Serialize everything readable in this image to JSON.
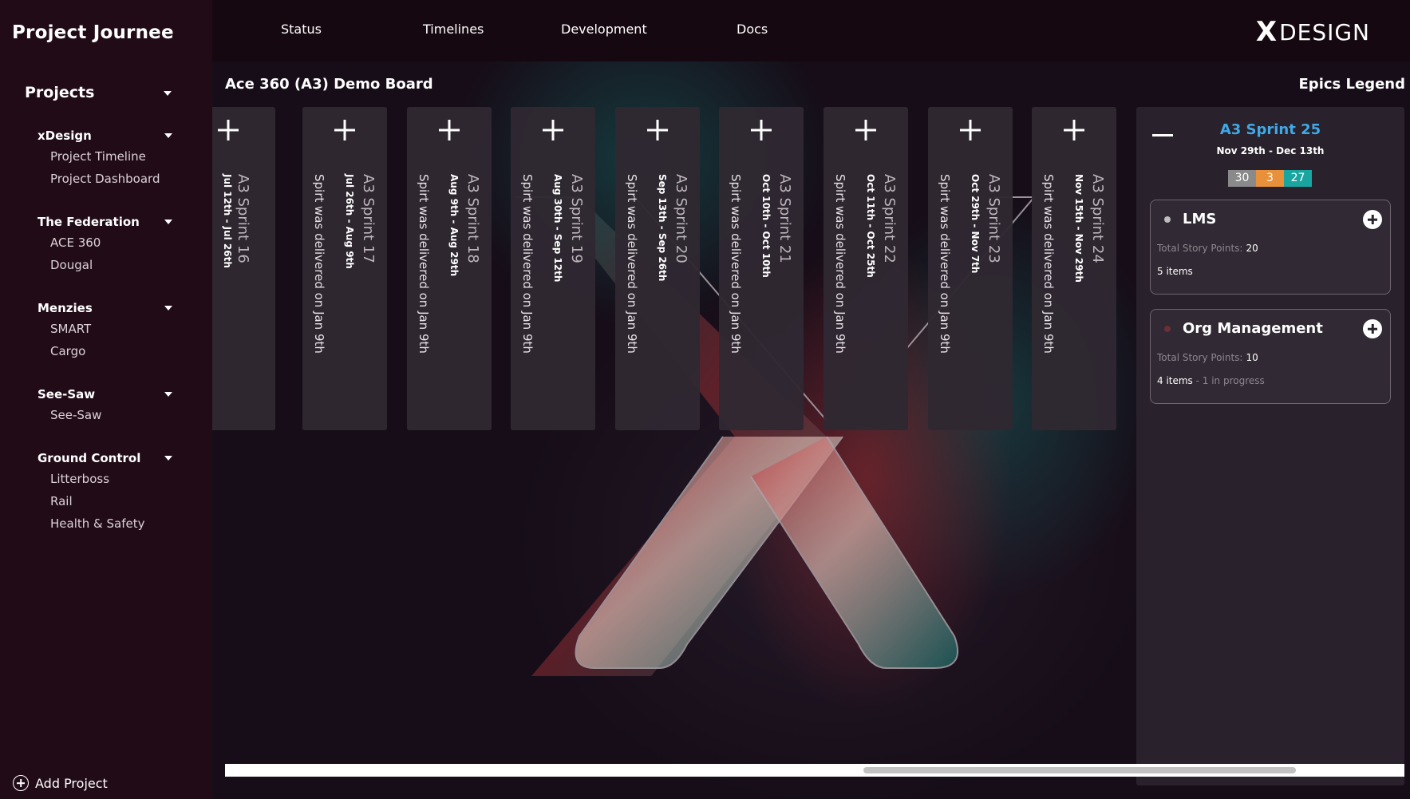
{
  "sidebar": {
    "app_title": "Project Journee",
    "projects_label": "Projects",
    "groups": [
      {
        "title": "xDesign",
        "items": [
          "Project Timeline",
          "Project Dashboard"
        ]
      },
      {
        "title": "The Federation",
        "items": [
          "ACE 360",
          "Dougal"
        ]
      },
      {
        "title": "Menzies",
        "items": [
          "SMART",
          "Cargo"
        ]
      },
      {
        "title": "See-Saw",
        "items": [
          "See-Saw"
        ]
      },
      {
        "title": "Ground Control",
        "items": [
          "Litterboss",
          "Rail",
          "Health & Safety"
        ]
      }
    ],
    "add_project_label": "Add Project"
  },
  "topbar": {
    "nav": [
      "Status",
      "Timelines",
      "Development",
      "Docs"
    ],
    "brand_x": "X",
    "brand_text": "DESIGN"
  },
  "board": {
    "title": "Ace 360 (A3) Demo Board",
    "legend_title": "Epics Legend",
    "sprints": [
      {
        "name": "A3 Sprint 16",
        "dates": "Jul 12th - Jul 26th",
        "note": ""
      },
      {
        "name": "A3 Sprint 17",
        "dates": "Jul 26th - Aug 9th",
        "note": "Spirt was delivered on Jan 9th"
      },
      {
        "name": "A3 Sprint 18",
        "dates": "Aug 9th - Aug 29th",
        "note": "Spirt was delivered on Jan 9th"
      },
      {
        "name": "A3 Sprint 19",
        "dates": "Aug 30th - Sep 12th",
        "note": "Spirt was delivered on Jan 9th"
      },
      {
        "name": "A3 Sprint 20",
        "dates": "Sep 13th - Sep 26th",
        "note": "Spirt was delivered on Jan 9th"
      },
      {
        "name": "A3 Sprint 21",
        "dates": "Oct 10th - Oct 10th",
        "note": "Spirt was delivered on Jan 9th"
      },
      {
        "name": "A3 Sprint 22",
        "dates": "Oct 11th - Oct 25th",
        "note": "Spirt was delivered on Jan 9th"
      },
      {
        "name": "A3 Sprint 23",
        "dates": "Oct 29th - Nov 7th",
        "note": "Spirt was delivered on Jan 9th"
      },
      {
        "name": "A3 Sprint 24",
        "dates": "Nov 15th - Nov 29th",
        "note": "Spirt was delivered on Jan 9th"
      }
    ],
    "active_sprint": {
      "name": "A3 Sprint 25",
      "dates": "Nov 29th - Dec 13th",
      "counts": [
        {
          "value": "30",
          "color": "#8a8a8a"
        },
        {
          "value": "3",
          "color": "#e8913a"
        },
        {
          "value": "27",
          "color": "#1aa6a0"
        }
      ],
      "epics": [
        {
          "name": "LMS",
          "points_label": "Total Story Points:",
          "points": "20",
          "items": "5 items",
          "progress": "",
          "dot_color": "#bdbdbd"
        },
        {
          "name": "Org Management",
          "points_label": "Total Story Points:",
          "points": "10",
          "items": "4 items",
          "progress": " - 1 in progress",
          "dot_color": "#6b2f3a"
        }
      ]
    }
  }
}
